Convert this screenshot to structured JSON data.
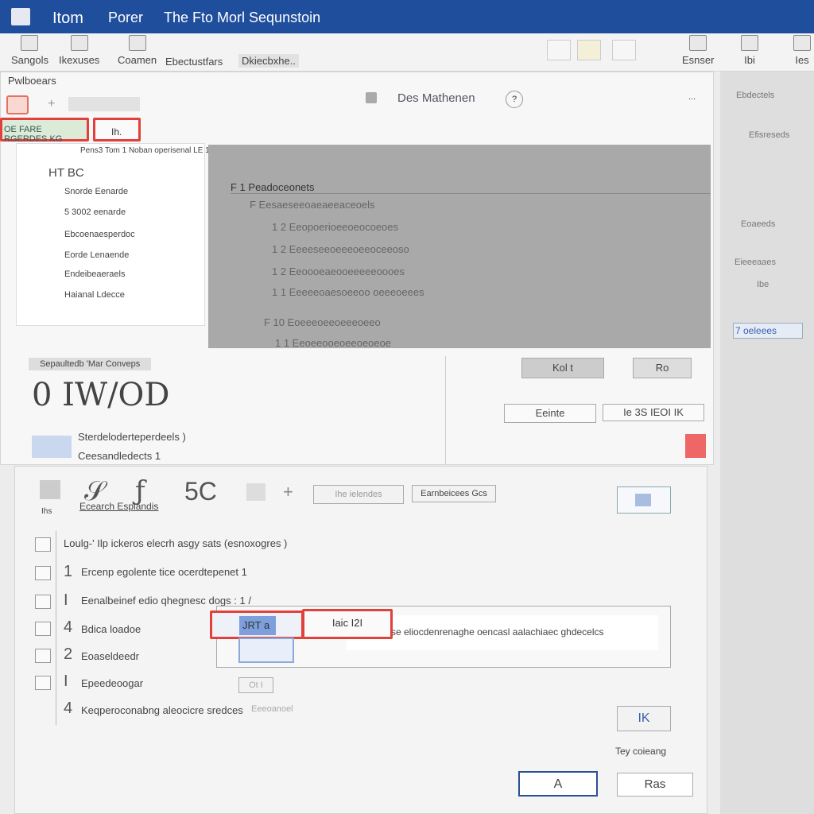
{
  "titlebar": {
    "app_icon": "app-menu-icon",
    "items": [
      "Itom",
      "Porer",
      "The Fto Morl Sequnstoin"
    ]
  },
  "ribbon": {
    "items": [
      "Sangols",
      "Ikexuses",
      "Coamen",
      "Ebectustfars",
      "Dkiecbxhe.."
    ],
    "right_items": [
      "Esnser",
      "Ibi",
      "Ies"
    ]
  },
  "sidebar": {
    "label": "Pwlboears",
    "filter_tag": "OE FARE RGERDES KG",
    "filter_field": "Ih.",
    "tree": [
      "Pens3 Tom 1 Noban operisenal LE 1 1S",
      "HT BC",
      "Snorde Eenarde",
      "5 3002 eenarde",
      "Ebcoenaesperdoc",
      "Eorde Lenaende",
      "Endeibeaeraels",
      "Haianal Ldecce"
    ],
    "footer": "Sepaultedb 'Mar Conveps"
  },
  "header": {
    "title": "Des Mathenen",
    "help": "?",
    "more": "..."
  },
  "preview": {
    "header": "F 1 Peadoceonets",
    "lines": [
      "F Eesaeseeoaeaeeaceoels",
      "1 2 Eeopoerioeeoeocoeoes",
      "1 2 Eeeeseeoeeeoeeoceeoso",
      "1 2 Eeoooeaeooeeeeeoooes",
      "1 1 Eeeeeoaesoeeoo oeeeoeees",
      "F 10 Eoeeeoeeoeeeoeeo",
      "1 1 Eeoeeooeoeeoeoeoe"
    ]
  },
  "mid": {
    "big_text": "0 IW/OD",
    "line1": "Sterdeloderteperdeels )",
    "line2": "Ceesandledects 1",
    "btn1": "Kol t",
    "btn2": "Ro",
    "field1": "Eeinte",
    "field2": "Ie 3S IEOI IK"
  },
  "right_panel": {
    "items": [
      "Ebdectels",
      "Efisreseds",
      "Eoaeeds",
      "Eieeeaaes",
      "Ibe",
      "7 oeleees"
    ]
  },
  "editor": {
    "toolbar_label": "Ihs",
    "search_label": "Ecearch Esplandis",
    "format_select": "Ihe ielendes",
    "format_button": "Earnbeicees Gcs",
    "lines": [
      {
        "n": "",
        "t": "Loulg-' Ilp ickeros elecrh asgy sats (esnoxogres )"
      },
      {
        "n": "1",
        "t": "Ercenp egolente tice ocerdtepenet 1"
      },
      {
        "n": "I",
        "t": "Eenalbeinef edio qhegnesc dogs : 1 /"
      },
      {
        "n": "4",
        "t": "Bdica loadoe"
      },
      {
        "n": "2",
        "t": "Eoaseldeedr"
      },
      {
        "n": "I",
        "t": "Epeedeoogar"
      },
      {
        "n": "4",
        "t": "Keqperoconabng aleocicre sredces"
      }
    ],
    "cell_a": "JRT a",
    "cell_b": "Iaic I2I",
    "cell_text": "se eliocdenrenaghe oencasl aalachiaec ghdecelcs",
    "small_chip": "Ot I",
    "small_chip2": "Eeeoanoel",
    "side_button": "IK",
    "side_label": "Tey coieang",
    "ok": "A",
    "cancel": "Ras"
  }
}
